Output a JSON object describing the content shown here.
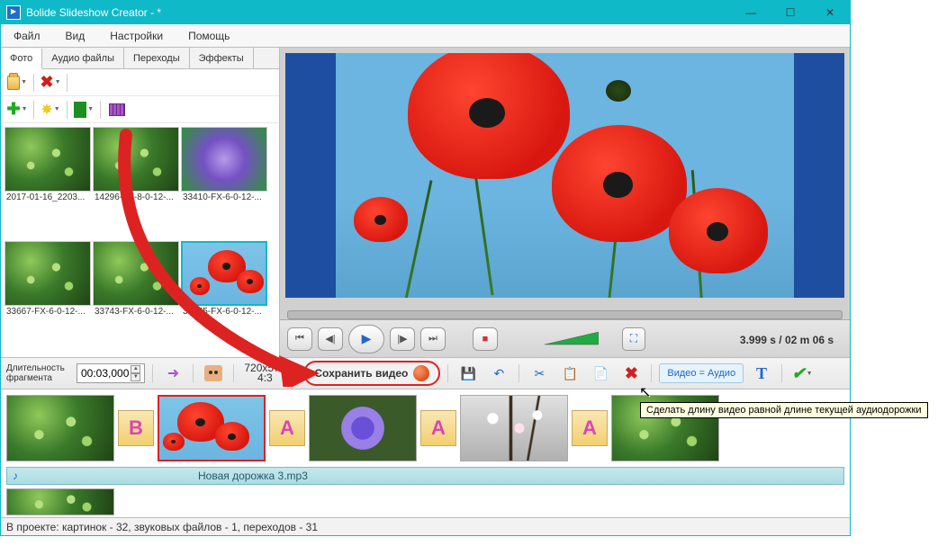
{
  "titlebar": {
    "title": "Bolide Slideshow Creator - *"
  },
  "menu": {
    "file": "Файл",
    "view": "Вид",
    "settings": "Настройки",
    "help": "Помощь"
  },
  "tabs": {
    "photo": "Фото",
    "audio": "Аудио файлы",
    "transitions": "Переходы",
    "effects": "Эффекты"
  },
  "thumbs": [
    {
      "label": "2017-01-16_2203..."
    },
    {
      "label": "14296-FX-8-0-12-..."
    },
    {
      "label": "33410-FX-6-0-12-..."
    },
    {
      "label": "33667-FX-6-0-12-..."
    },
    {
      "label": "33743-FX-6-0-12-..."
    },
    {
      "label": "37055-FX-6-0-12-..."
    }
  ],
  "playback": {
    "current": "3.999 s",
    "sep": " / ",
    "total": "02 m 06 s"
  },
  "duration": {
    "label": "Длительность фрагмента",
    "value": "00:03,000"
  },
  "resolution": {
    "wh": "720x576",
    "aspect": "4:3"
  },
  "save_video_btn": "Сохранить видео",
  "video_audio_btn": "Видео = Аудио",
  "tooltip": "Сделать длину видео равной длине текущей аудиодорожки",
  "transitions": {
    "b": "B",
    "a1": "A",
    "a2": "A",
    "a3": "A"
  },
  "audio_track": {
    "name": "Новая дорожка 3.mp3"
  },
  "status": "В проекте: картинок - 32, звуковых файлов - 1, переходов - 31"
}
